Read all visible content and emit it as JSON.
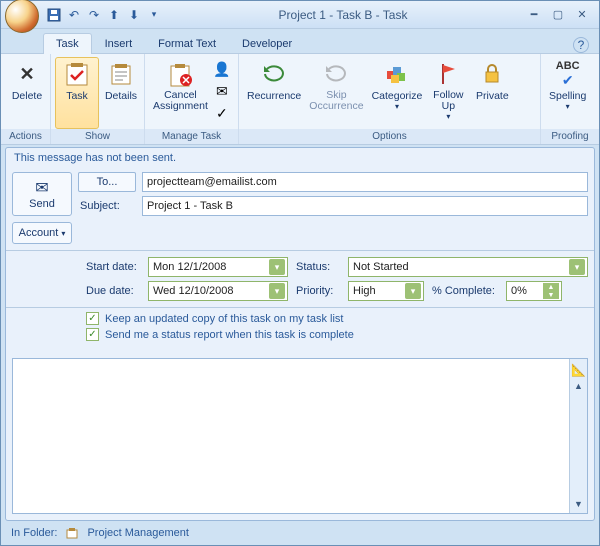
{
  "window": {
    "title": "Project 1 - Task B - Task"
  },
  "qat": {
    "save": "save-icon",
    "undo": "undo-icon",
    "redo": "redo-icon",
    "prev": "prev-icon",
    "next": "next-icon",
    "more": "▾"
  },
  "tabs": [
    "Task",
    "Insert",
    "Format Text",
    "Developer"
  ],
  "ribbon": {
    "actions": {
      "label": "Actions",
      "delete": "Delete"
    },
    "show": {
      "label": "Show",
      "task": "Task",
      "details": "Details"
    },
    "manage": {
      "label": "Manage Task",
      "cancel": "Cancel\nAssignment"
    },
    "options": {
      "label": "Options",
      "recurrence": "Recurrence",
      "skip": "Skip\nOccurrence",
      "categorize": "Categorize\n",
      "follow": "Follow\nUp",
      "private": "Private"
    },
    "proofing": {
      "label": "Proofing",
      "spelling": "Spelling\n"
    }
  },
  "info": "This message has not been sent.",
  "send": {
    "label": "Send",
    "account": "Account"
  },
  "form": {
    "to_label": "To...",
    "to_value": "projectteam@emailist.com",
    "subject_label": "Subject:",
    "subject_value": "Project 1 - Task B",
    "start_label": "Start date:",
    "start_value": "Mon 12/1/2008",
    "due_label": "Due date:",
    "due_value": "Wed 12/10/2008",
    "status_label": "Status:",
    "status_value": "Not Started",
    "priority_label": "Priority:",
    "priority_value": "High",
    "pct_label": "% Complete:",
    "pct_value": "0%",
    "chk1": "Keep an updated copy of this task on my task list",
    "chk2": "Send me a status report when this task is complete"
  },
  "status": {
    "folder_label": "In Folder:",
    "folder_value": "Project Management"
  }
}
